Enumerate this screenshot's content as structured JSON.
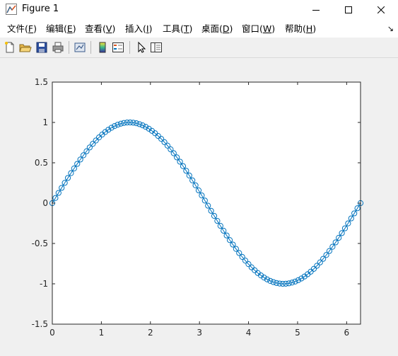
{
  "window": {
    "title": "Figure 1",
    "app_icon": "matlab-figure-icon",
    "controls": [
      "minimize-icon",
      "maximize-icon",
      "close-icon"
    ]
  },
  "menubar": {
    "items": [
      {
        "label": "文件(",
        "key": "F",
        "suffix": ")"
      },
      {
        "label": "编辑(",
        "key": "E",
        "suffix": ")"
      },
      {
        "label": "查看(",
        "key": "V",
        "suffix": ")"
      },
      {
        "label": "插入(",
        "key": "I",
        "suffix": ")"
      },
      {
        "label": "工具(",
        "key": "T",
        "suffix": ")"
      },
      {
        "label": "桌面(",
        "key": "D",
        "suffix": ")"
      },
      {
        "label": "窗口(",
        "key": "W",
        "suffix": ")"
      },
      {
        "label": "帮助(",
        "key": "H",
        "suffix": ")"
      }
    ],
    "overflow_icon": "dock-arrow-icon"
  },
  "toolbar": {
    "buttons": [
      "new-figure-icon",
      "open-file-icon",
      "save-icon",
      "print-icon",
      "link-plot-icon",
      "colorbar-icon",
      "legend-icon",
      "pointer-icon",
      "property-inspector-icon"
    ]
  },
  "chart_data": {
    "type": "line",
    "marker": "circle",
    "color": "#0072bd",
    "xlim": [
      0,
      6.2832
    ],
    "ylim": [
      -1.5,
      1.5
    ],
    "x_ticks": [
      "0",
      "1",
      "2",
      "3",
      "4",
      "5",
      "6"
    ],
    "y_ticks": [
      "1.5",
      "1",
      "0.5",
      "0",
      "-0.5",
      "-1",
      "-1.5"
    ],
    "grid": false,
    "series": [
      {
        "function": "sin(x)",
        "x_start": 0,
        "x_end": 6.2832,
        "num_points": 100
      }
    ]
  }
}
